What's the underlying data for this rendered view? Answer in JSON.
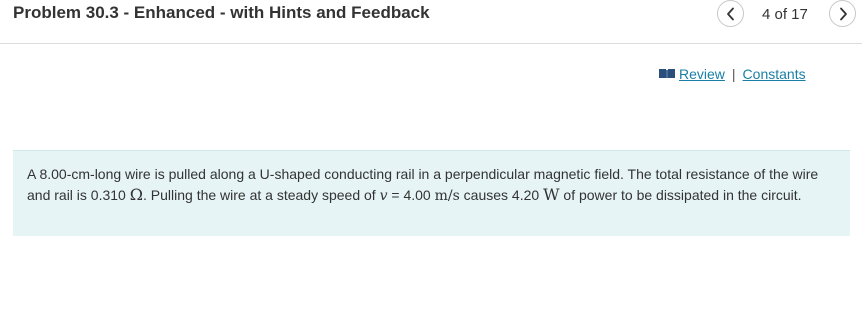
{
  "header": {
    "title": "Problem 30.3 - Enhanced - with Hints and Feedback",
    "counter": "4 of 17",
    "prev_icon": "chevron-left-icon",
    "next_icon": "chevron-right-icon"
  },
  "links": {
    "book_icon": "book-icon",
    "review": "Review",
    "separator": "|",
    "constants": "Constants",
    "link_color": "#1a7fa6",
    "icon_color": "#2a4f7a"
  },
  "problem": {
    "background": "#e6f4f6",
    "text_1": "A 8.00-cm-long wire is pulled along a U-shaped conducting rail in a perpendicular magnetic field. The total resistance of the wire and rail is 0.310 ",
    "ohm_symbol": "Ω",
    "text_2": ". Pulling the wire at a steady speed of ",
    "speed_symbol": "v",
    "equals": " = 4.00 ",
    "speed_unit": "m/s",
    "text_3": " causes 4.20 ",
    "power_unit": "W",
    "text_4": " of power to be dissipated in the circuit."
  }
}
